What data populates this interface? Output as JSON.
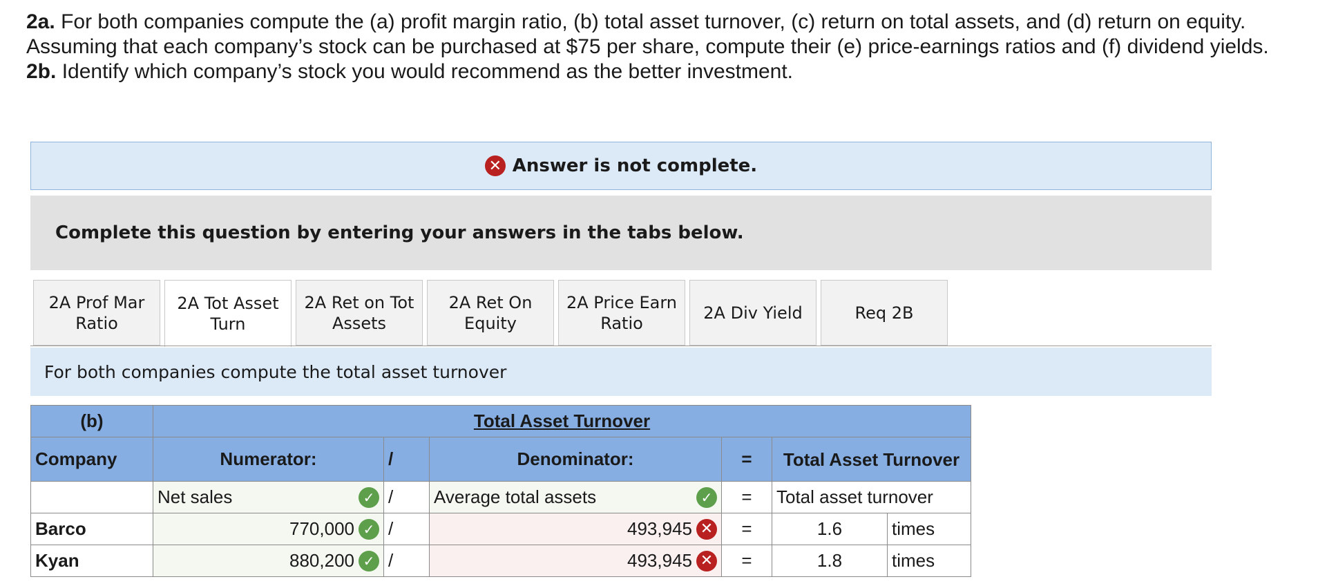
{
  "question": {
    "q2a_label": "2a.",
    "q2a_text": "For both companies compute the (a) profit margin ratio, (b) total asset turnover, (c) return on total assets, and (d) return on equity. Assuming that each company’s stock can be purchased at $75 per share, compute their (e) price-earnings ratios and (f) dividend yields.",
    "q2b_label": "2b.",
    "q2b_text": "Identify which company’s stock you would recommend as the better investment."
  },
  "status": {
    "icon": "error-x-icon",
    "text": "Answer is not complete."
  },
  "instruction": "Complete this question by entering your answers in the tabs below.",
  "tabs": [
    {
      "label": "2A Prof Mar Ratio"
    },
    {
      "label": "2A Tot Asset Turn"
    },
    {
      "label": "2A Ret on Tot Assets"
    },
    {
      "label": "2A Ret On Equity"
    },
    {
      "label": "2A Price Earn Ratio"
    },
    {
      "label": "2A Div Yield"
    },
    {
      "label": "Req 2B"
    }
  ],
  "active_tab": "2A Tot Asset Turn",
  "tab_description": "For both companies compute the total asset turnover",
  "table": {
    "part_label": "(b)",
    "title": "Total Asset Turnover",
    "col_company": "Company",
    "col_numerator": "Numerator:",
    "div_symbol": "/",
    "col_denominator": "Denominator:",
    "eq_symbol": "=",
    "col_result": "Total Asset Turnover",
    "label_row": {
      "numerator": "Net sales",
      "denominator": "Average total assets",
      "result": "Total asset turnover"
    },
    "rows": [
      {
        "company": "Barco",
        "numerator": "770,000",
        "denominator": "493,945",
        "result": "1.6",
        "unit": "times"
      },
      {
        "company": "Kyan",
        "numerator": "880,200",
        "denominator": "493,945",
        "result": "1.8",
        "unit": "times"
      }
    ]
  },
  "colors": {
    "header_blue": "#86aee3",
    "status_bg": "#dce9f7",
    "correct_green": "#5e9f4b",
    "incorrect_red": "#b8211f"
  }
}
